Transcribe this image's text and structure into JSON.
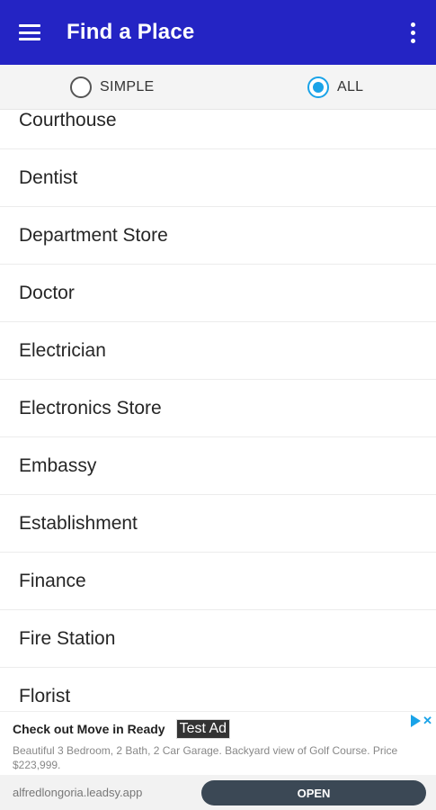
{
  "appbar": {
    "title": "Find a Place",
    "menu_icon": "menu-icon",
    "more_icon": "more-vert-icon",
    "color": "#2424c4"
  },
  "filter": {
    "options": [
      {
        "label": "SIMPLE",
        "selected": false
      },
      {
        "label": "ALL",
        "selected": true
      }
    ],
    "accent": "#1aa3e8"
  },
  "places": [
    "Courthouse",
    "Dentist",
    "Department Store",
    "Doctor",
    "Electrician",
    "Electronics Store",
    "Embassy",
    "Establishment",
    "Finance",
    "Fire Station",
    "Florist"
  ],
  "ad": {
    "title": "Check out Move in Ready",
    "badge": "Test Ad",
    "body": "Beautiful 3 Bedroom, 2 Bath, 2 Car Garage. Backyard view of Golf Course. Price $223,999.",
    "url": "alfredlongoria.leadsy.app",
    "cta": "OPEN",
    "choices_icon": "adchoices-icon"
  }
}
